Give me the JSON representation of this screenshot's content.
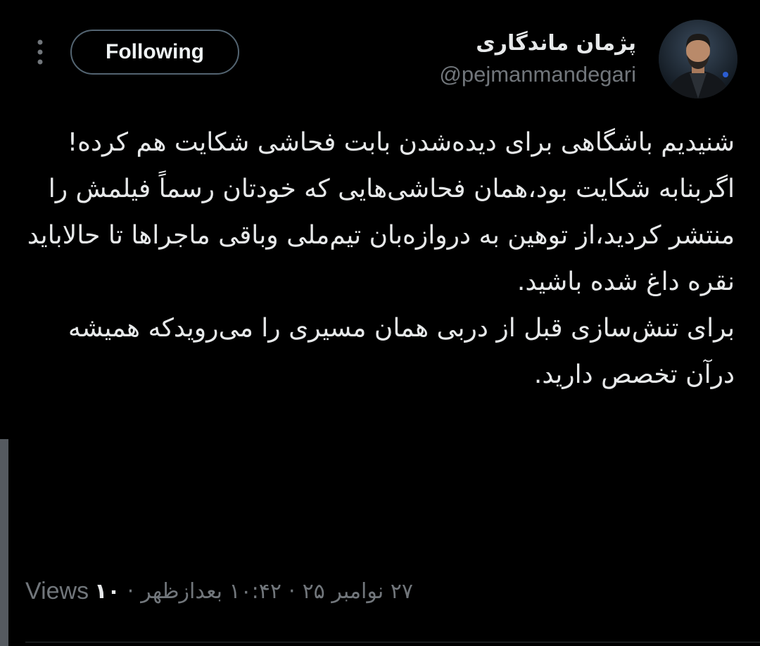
{
  "tweet": {
    "author": {
      "display_name": "پژمان ماندگاری",
      "handle": "@pejmanmandegari"
    },
    "follow_button_label": "Following",
    "paragraphs": [
      "شنیدیم باشگاهی برای دیده‌شدن بابت فحاشی شکایت هم کرده!",
      "اگربنابه شکایت بود،همان فحاشی‌هایی که خودتان رسماً فیلمش را منتشر کردید،از توهین به دروازه‌بان تیم‌ملی وباقی ماجراها تا حالاباید نقره داغ شده باشید.",
      "برای تنش‌سازی قبل از دربی همان مسیری را می‌رویدکه همیشه درآن تخصص دارید."
    ],
    "meta": {
      "time": "۱۰:۴۲ بعدازظهر",
      "date": "۲۷ نوامبر ۲۵",
      "views_count": "۱۰",
      "views_label": "Views",
      "separator": "·"
    }
  },
  "icons": {
    "more": "more-vertical-icon"
  },
  "colors": {
    "background": "#000000",
    "text_primary": "#e7e9ea",
    "text_secondary": "#71767b",
    "button_border": "#536471"
  }
}
